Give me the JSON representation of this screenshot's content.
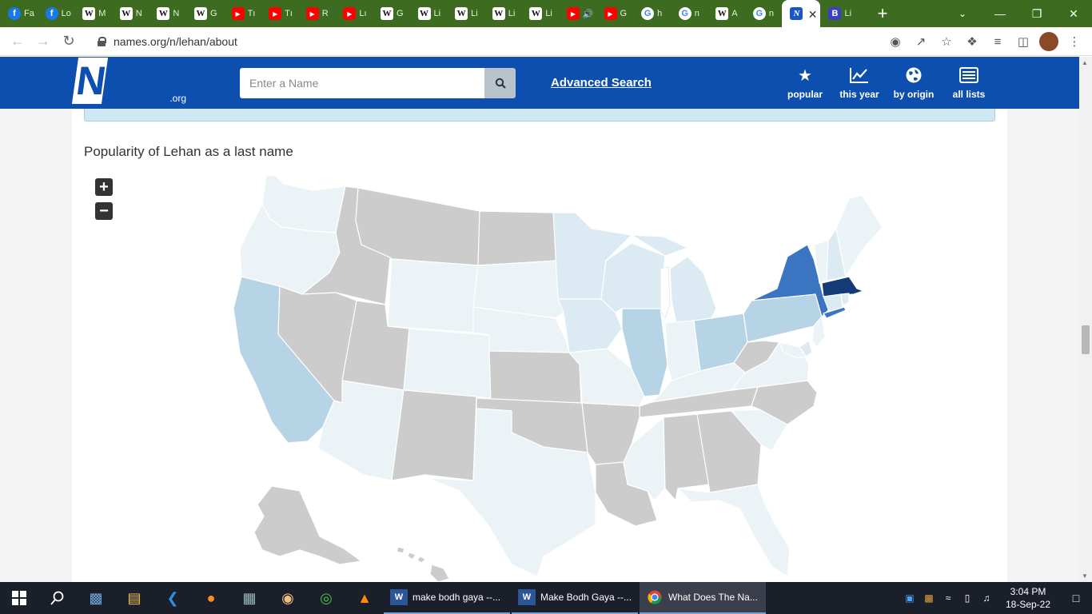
{
  "browser": {
    "tabs": [
      {
        "icon": "facebook",
        "label": "Fa"
      },
      {
        "icon": "facebook",
        "label": "Lo"
      },
      {
        "icon": "wikipedia",
        "label": "M"
      },
      {
        "icon": "wikipedia",
        "label": "N"
      },
      {
        "icon": "wikipedia",
        "label": "N"
      },
      {
        "icon": "wikipedia",
        "label": "G"
      },
      {
        "icon": "youtube",
        "label": "Tı"
      },
      {
        "icon": "youtube",
        "label": "Tı"
      },
      {
        "icon": "youtube",
        "label": "R"
      },
      {
        "icon": "youtube",
        "label": "Lı"
      },
      {
        "icon": "wikipedia",
        "label": "G"
      },
      {
        "icon": "wikipedia",
        "label": "Li"
      },
      {
        "icon": "wikipedia",
        "label": "Li"
      },
      {
        "icon": "wikipedia",
        "label": "Li"
      },
      {
        "icon": "wikipedia",
        "label": "Li"
      },
      {
        "icon": "youtube",
        "label": "🔊"
      },
      {
        "icon": "youtube",
        "label": "G"
      },
      {
        "icon": "google",
        "label": "h"
      },
      {
        "icon": "google",
        "label": "n"
      },
      {
        "icon": "wikipedia",
        "label": "A"
      },
      {
        "icon": "google",
        "label": "n"
      },
      {
        "icon": "names",
        "label": "",
        "active": true
      },
      {
        "icon": "b",
        "label": "Li"
      }
    ],
    "url": "names.org/n/lehan/about"
  },
  "site": {
    "logo_text": "Names",
    "logo_sub": ".org",
    "search_placeholder": "Enter a Name",
    "advanced_search": "Advanced Search",
    "nav": [
      {
        "icon": "star-icon",
        "label": "popular"
      },
      {
        "icon": "chart-line-icon",
        "label": "this year"
      },
      {
        "icon": "globe-icon",
        "label": "by origin"
      },
      {
        "icon": "list-icon",
        "label": "all lists"
      }
    ]
  },
  "main": {
    "map_title": "Popularity of Lehan as a last name",
    "zoom_in": "+",
    "zoom_out": "−"
  },
  "map_colors": {
    "none": "#cccccc",
    "lowest": "#ecf3f7",
    "low": "#dcebf3",
    "mid": "#b7d4e6",
    "high": "#3b74c0",
    "highest": "#143a78"
  },
  "taskbar": {
    "tasks": [
      {
        "icon": "word",
        "label": "make bodh gaya --..."
      },
      {
        "icon": "word",
        "label": "Make Bodh Gaya --..."
      },
      {
        "icon": "chrome",
        "label": "What Does The Na...",
        "active": true
      }
    ],
    "time": "3:04 PM",
    "date": "18-Sep-22"
  }
}
